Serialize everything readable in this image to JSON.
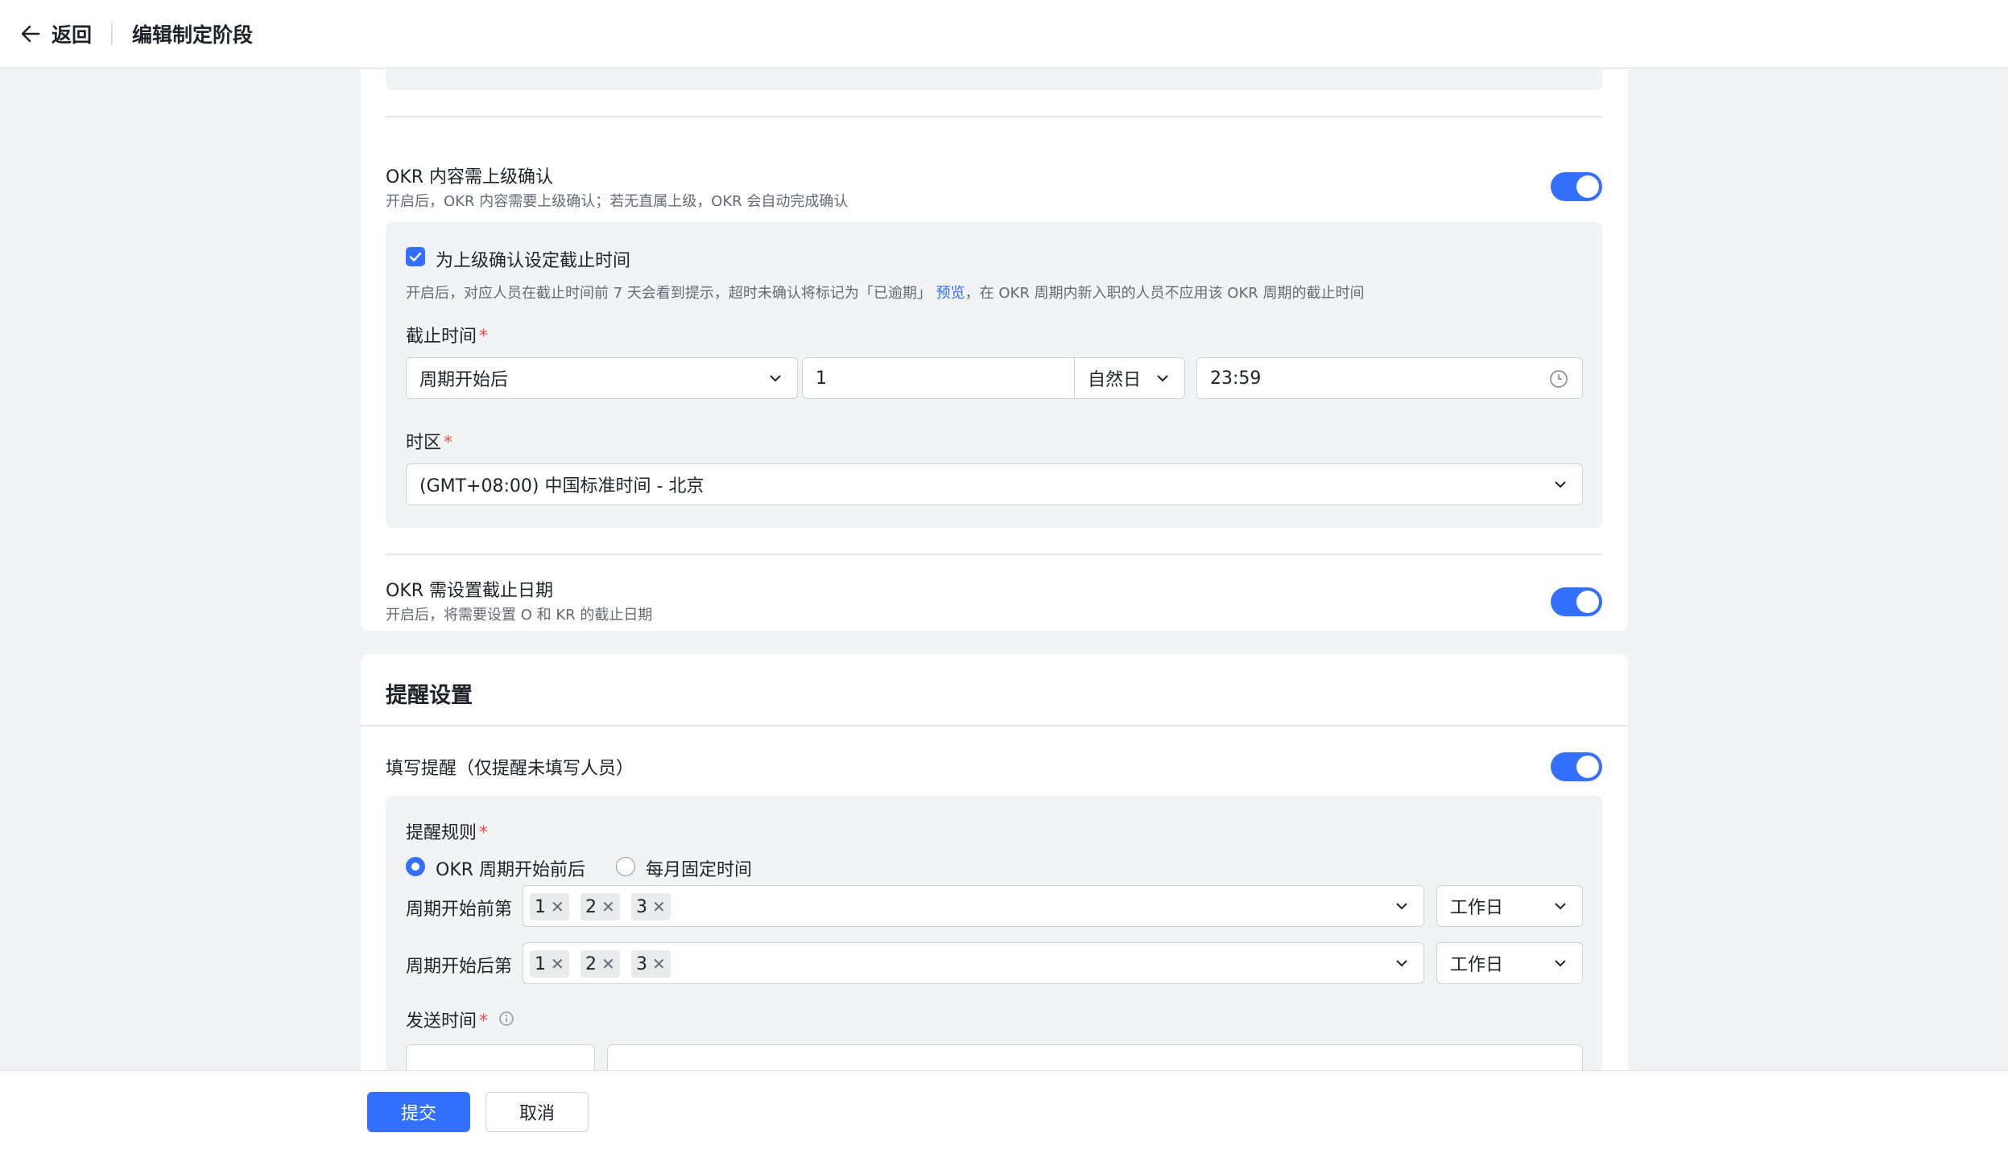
{
  "header": {
    "back_label": "返回",
    "title": "编辑制定阶段"
  },
  "okr_confirm": {
    "title": "OKR 内容需上级确认",
    "desc": "开启后，OKR 内容需要上级确认；若无直属上级，OKR 会自动完成确认",
    "enabled": true,
    "deadline_checkbox_label": "为上级确认设定截止时间",
    "deadline_hint_prefix": "开启后，对应人员在截止时间前 7 天会看到提示，超时未确认将标记为「已逾期」",
    "deadline_hint_link": "预览",
    "deadline_hint_suffix": "，在 OKR 周期内新入职的人员不应用该 OKR 周期的截止时间",
    "deadline_label": "截止时间",
    "deadline_anchor": "周期开始后",
    "deadline_amount": "1",
    "deadline_unit": "自然日",
    "deadline_time": "23:59",
    "timezone_label": "时区",
    "timezone_value": "(GMT+08:00) 中国标准时间 - 北京"
  },
  "okr_due": {
    "title": "OKR 需设置截止日期",
    "desc": "开启后，将需要设置 O 和 KR 的截止日期",
    "enabled": true
  },
  "reminder": {
    "section_title": "提醒设置",
    "fill_title": "填写提醒（仅提醒未填写人员）",
    "enabled": true,
    "rule_label": "提醒规则",
    "rule_options": [
      "OKR 周期开始前后",
      "每月固定时间"
    ],
    "rule_selected": "OKR 周期开始前后",
    "before_label": "周期开始前第",
    "before_tags": [
      "1",
      "2",
      "3"
    ],
    "before_unit": "工作日",
    "after_label": "周期开始后第",
    "after_tags": [
      "1",
      "2",
      "3"
    ],
    "after_unit": "工作日",
    "send_time_label": "发送时间"
  },
  "footer": {
    "submit": "提交",
    "cancel": "取消"
  },
  "colors": {
    "primary": "#3370ff",
    "required": "#f54a45"
  }
}
